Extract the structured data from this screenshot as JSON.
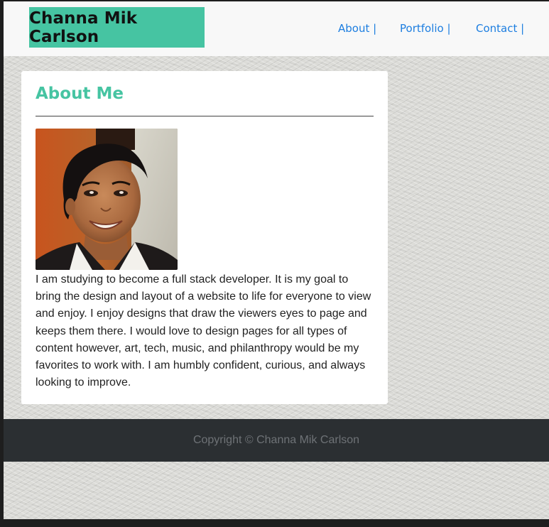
{
  "header": {
    "brand": "Channa Mik Carlson",
    "nav": [
      {
        "label": "About |"
      },
      {
        "label": "Portfolio |"
      },
      {
        "label": "Contact |"
      }
    ]
  },
  "about": {
    "heading": "About Me",
    "photo_alt": "Portrait of Channa Mik Carlson smiling",
    "bio": "I am studying to become a full stack developer. It is my goal to bring the design and layout of a website to life for everyone to view and enjoy. I enjoy designs that draw the viewers eyes to page and keeps them there. I would love to design pages for all types of content however, art, tech, music, and philanthropy would be my favorites to work with. I am humbly confident, curious, and always looking to improve."
  },
  "footer": {
    "copyright": "Copyright © Channa Mik Carlson"
  },
  "colors": {
    "accent": "#46c4a2",
    "link": "#1d7ee0",
    "footer_bg": "#2b2f32"
  }
}
